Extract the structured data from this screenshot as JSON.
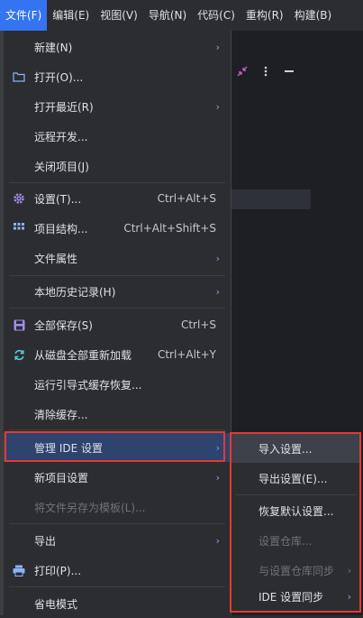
{
  "menubar": {
    "items": [
      "文件(F)",
      "编辑(E)",
      "视图(V)",
      "导航(N)",
      "代码(C)",
      "重构(R)",
      "构建(B)"
    ]
  },
  "menu": {
    "new": {
      "label": "新建(N)"
    },
    "open": {
      "label": "打开(O)..."
    },
    "recent": {
      "label": "打开最近(R)"
    },
    "remote": {
      "label": "远程开发..."
    },
    "close": {
      "label": "关闭项目(J)"
    },
    "settings": {
      "label": "设置(T)...",
      "shortcut": "Ctrl+Alt+S"
    },
    "structure": {
      "label": "项目结构...",
      "shortcut": "Ctrl+Alt+Shift+S"
    },
    "props": {
      "label": "文件属性"
    },
    "history": {
      "label": "本地历史记录(H)"
    },
    "saveall": {
      "label": "全部保存(S)",
      "shortcut": "Ctrl+S"
    },
    "reload": {
      "label": "从磁盘全部重新加载",
      "shortcut": "Ctrl+Alt+Y"
    },
    "guided": {
      "label": "运行引导式缓存恢复..."
    },
    "cache": {
      "label": "清除缓存..."
    },
    "manage": {
      "label": "管理 IDE 设置"
    },
    "newproj": {
      "label": "新项目设置"
    },
    "template": {
      "label": "将文件另存为模板(L)..."
    },
    "export": {
      "label": "导出"
    },
    "print": {
      "label": "打印(P)..."
    },
    "power": {
      "label": "省电模式"
    }
  },
  "submenu": {
    "import": "导入设置...",
    "export": "导出设置(E)...",
    "restore": "恢复默认设置...",
    "repo": "设置仓库...",
    "reposync": "与设置仓库同步",
    "idesync": "IDE 设置同步"
  },
  "colors": {
    "accent": "#3574f0",
    "highlight_box": "#e53935",
    "arrow": "#7aa4ff"
  }
}
